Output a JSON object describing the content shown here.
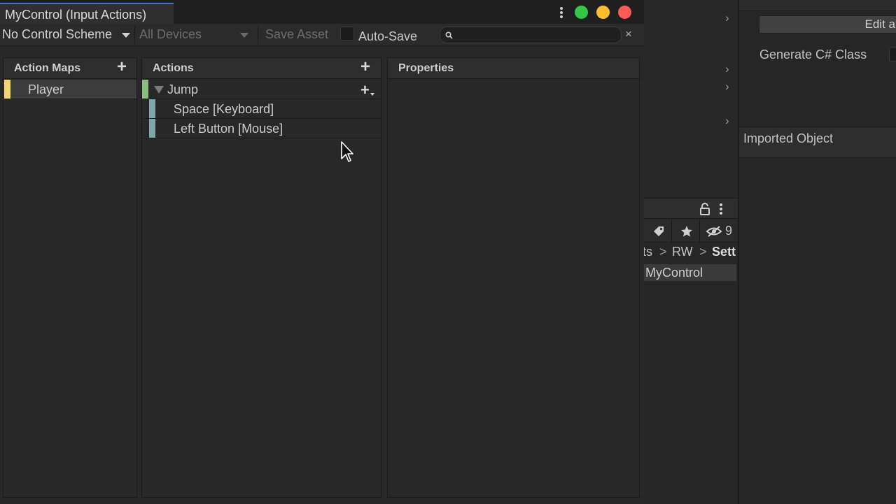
{
  "window": {
    "tab_title": "MyControl (Input Actions)"
  },
  "toolbar": {
    "control_scheme": "No Control Scheme",
    "devices": "All Devices",
    "save_asset": "Save Asset",
    "auto_save_label": "Auto-Save",
    "auto_save_checked": false,
    "search_value": "",
    "search_clear": "×"
  },
  "panels": {
    "action_maps": {
      "title": "Action Maps",
      "add": "+",
      "items": [
        {
          "label": "Player",
          "selected": true,
          "color": "#f2d479"
        }
      ]
    },
    "actions": {
      "title": "Actions",
      "add": "+",
      "items": [
        {
          "label": "Jump",
          "expanded": true,
          "color": "#86c07a",
          "add_binding": "+"
        },
        {
          "label": "Space [Keyboard]",
          "color": "#7aa8ad"
        },
        {
          "label": "Left Button [Mouse]",
          "color": "#7aa8ad"
        }
      ]
    },
    "properties": {
      "title": "Properties"
    }
  },
  "inspector": {
    "edit_button": "Edit a",
    "generate_class_label": "Generate C# Class",
    "imported_object": "Imported Object"
  },
  "project": {
    "hidden_count": "9",
    "breadcrumb": [
      "ts",
      "RW",
      "Sett"
    ],
    "breadcrumb_sep": ">",
    "selected_asset": "MyControl"
  },
  "colors": {
    "accent_tab": "#3a78c6",
    "action_map_color": "#f2d479",
    "action_color": "#86c07a",
    "binding_color": "#7aa8ad"
  }
}
